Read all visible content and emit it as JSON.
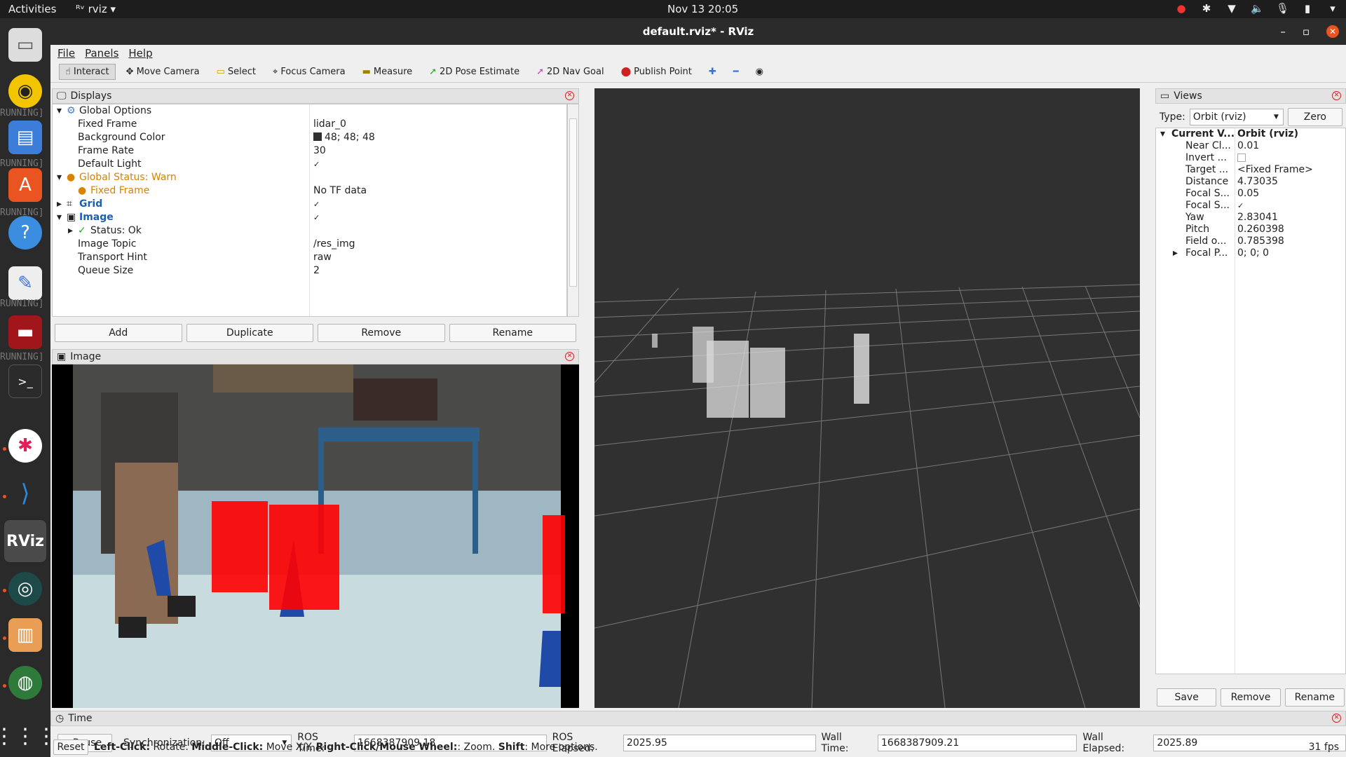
{
  "topbar": {
    "activities": "Activities",
    "app_name": "rviz",
    "clock": "Nov 13  20:05"
  },
  "dock": {
    "running_text": "RUNNING]"
  },
  "window": {
    "title": "default.rviz* - RViz",
    "menu": [
      "File",
      "Panels",
      "Help"
    ]
  },
  "toolbar": {
    "tools": [
      "Interact",
      "Move Camera",
      "Select",
      "Focus Camera",
      "Measure",
      "2D Pose Estimate",
      "2D Nav Goal",
      "Publish Point"
    ]
  },
  "displays": {
    "title": "Displays",
    "rows": [
      {
        "label": "Global Options",
        "value": ""
      },
      {
        "label": "Fixed Frame",
        "value": "lidar_0"
      },
      {
        "label": "Background Color",
        "value": "48; 48; 48"
      },
      {
        "label": "Frame Rate",
        "value": "30"
      },
      {
        "label": "Default Light",
        "value": "✓"
      },
      {
        "label": "Global Status: Warn",
        "value": ""
      },
      {
        "label": "Fixed Frame",
        "value": "No TF data"
      },
      {
        "label": "Grid",
        "value": "✓"
      },
      {
        "label": "Image",
        "value": "✓"
      },
      {
        "label": "Status: Ok",
        "value": ""
      },
      {
        "label": "Image Topic",
        "value": "/res_img"
      },
      {
        "label": "Transport Hint",
        "value": "raw"
      },
      {
        "label": "Queue Size",
        "value": "2"
      }
    ],
    "buttons": [
      "Add",
      "Duplicate",
      "Remove",
      "Rename"
    ],
    "bg_color_swatch": "#303030"
  },
  "image_panel": {
    "title": "Image"
  },
  "views": {
    "title": "Views",
    "type_label": "Type:",
    "type_value": "Orbit (rviz)",
    "zero_button": "Zero",
    "rows": [
      {
        "label": "Current V...",
        "value": "Orbit (rviz)"
      },
      {
        "label": "Near Cl...",
        "value": "0.01"
      },
      {
        "label": "Invert ...",
        "value": ""
      },
      {
        "label": "Target ...",
        "value": "<Fixed Frame>"
      },
      {
        "label": "Distance",
        "value": "4.73035"
      },
      {
        "label": "Focal S...",
        "value": "0.05"
      },
      {
        "label": "Focal S...",
        "value": "✓"
      },
      {
        "label": "Yaw",
        "value": "2.83041"
      },
      {
        "label": "Pitch",
        "value": "0.260398"
      },
      {
        "label": "Field o...",
        "value": "0.785398"
      },
      {
        "label": "Focal P...",
        "value": "0; 0; 0"
      }
    ],
    "buttons": [
      "Save",
      "Remove",
      "Rename"
    ]
  },
  "time": {
    "title": "Time",
    "pause": "Pause",
    "sync_label": "Synchronization:",
    "sync_value": "Off",
    "ros_time_label": "ROS Time:",
    "ros_time": "1668387909.18",
    "ros_elapsed_label": "ROS Elapsed:",
    "ros_elapsed": "2025.95",
    "wall_time_label": "Wall Time:",
    "wall_time": "1668387909.21",
    "wall_elapsed_label": "Wall Elapsed:",
    "wall_elapsed": "2025.89",
    "reset": "Reset",
    "hint_b1": "Left-Click:",
    "hint_t1": " Rotate. ",
    "hint_b2": "Middle-Click:",
    "hint_t2": " Move X/Y. ",
    "hint_b3": "Right-Click/Mouse Wheel:",
    "hint_t3": ": Zoom. ",
    "hint_b4": "Shift",
    "hint_t4": ": More options.",
    "fps": "31 fps"
  },
  "colors": {
    "accent": "#e95420",
    "warn": "#d98200",
    "link_blue": "#1e5fb3",
    "view_bg": "#303030",
    "points_red": "#ff0000"
  }
}
